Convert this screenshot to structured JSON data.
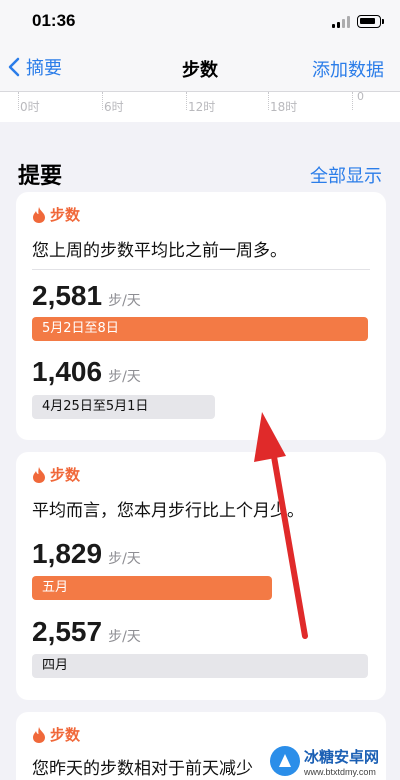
{
  "status_bar": {
    "time": "01:36"
  },
  "nav": {
    "back_label": "摘要",
    "title": "步数",
    "add_label": "添加数据"
  },
  "axis": {
    "labels": [
      "0时",
      "6时",
      "12时",
      "18时"
    ],
    "zero_label": "0"
  },
  "section": {
    "title": "提要",
    "show_all": "全部显示"
  },
  "cards": [
    {
      "category": "步数",
      "description": "您上周的步数平均比之前一周多。",
      "stats": [
        {
          "value": "2,581",
          "unit": "步/天",
          "period": "5月2日至8日"
        },
        {
          "value": "1,406",
          "unit": "步/天",
          "period": "4月25日至5月1日"
        }
      ]
    },
    {
      "category": "步数",
      "description": "平均而言，您本月步行比上个月少。",
      "stats": [
        {
          "value": "1,829",
          "unit": "步/天",
          "period": "五月"
        },
        {
          "value": "2,557",
          "unit": "步/天",
          "period": "四月"
        }
      ]
    },
    {
      "category": "步数",
      "description": "您昨天的步数相对于前天减少"
    }
  ],
  "colors": {
    "accent": "#2b7de9",
    "orange": "#f37a45",
    "flame": "#f0683a",
    "arrow": "#e02a2a"
  },
  "watermark": {
    "title": "冰糖安卓网",
    "url": "www.btxtdmy.com"
  }
}
